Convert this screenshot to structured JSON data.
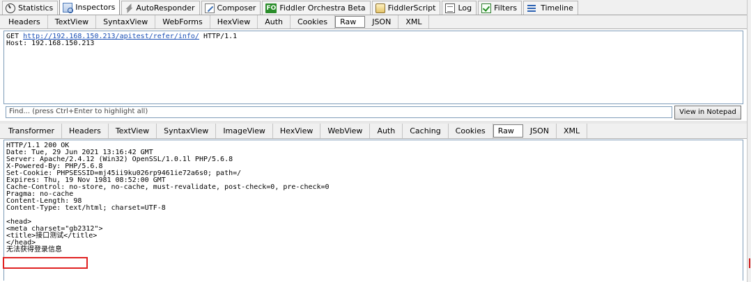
{
  "toptabs": [
    {
      "label": "Statistics",
      "icon": "stopwatch-icon"
    },
    {
      "label": "Inspectors",
      "icon": "inspectors-icon"
    },
    {
      "label": "AutoResponder",
      "icon": "lightning-icon"
    },
    {
      "label": "Composer",
      "icon": "pencil-icon"
    },
    {
      "label": "Fiddler Orchestra Beta",
      "icon": "fo-icon",
      "icon_text": "FO"
    },
    {
      "label": "FiddlerScript",
      "icon": "script-icon"
    },
    {
      "label": "Log",
      "icon": "log-icon"
    },
    {
      "label": "Filters",
      "icon": "checkbox-icon"
    },
    {
      "label": "Timeline",
      "icon": "timeline-icon"
    }
  ],
  "request_tabs": [
    "Headers",
    "TextView",
    "SyntaxView",
    "WebForms",
    "HexView",
    "Auth",
    "Cookies",
    "Raw",
    "JSON",
    "XML"
  ],
  "request": {
    "method": "GET",
    "url": "http://192.168.150.213/apitest/refer/info/",
    "protocol": "HTTP/1.1",
    "host_line": "Host: 192.168.150.213"
  },
  "find": {
    "placeholder": "Find... (press Ctrl+Enter to highlight all)",
    "button_label": "View in Notepad"
  },
  "response_tabs": [
    "Transformer",
    "Headers",
    "TextView",
    "SyntaxView",
    "ImageView",
    "HexView",
    "WebView",
    "Auth",
    "Caching",
    "Cookies",
    "Raw",
    "JSON",
    "XML"
  ],
  "response_lines": [
    "HTTP/1.1 200 OK",
    "Date: Tue, 29 Jun 2021 13:16:42 GMT",
    "Server: Apache/2.4.12 (Win32) OpenSSL/1.0.1l PHP/5.6.8",
    "X-Powered-By: PHP/5.6.8",
    "Set-Cookie: PHPSESSID=mj45ii9ku026rp9461ie72a6s0; path=/",
    "Expires: Thu, 19 Nov 1981 08:52:00 GMT",
    "Cache-Control: no-store, no-cache, must-revalidate, post-check=0, pre-check=0",
    "Pragma: no-cache",
    "Content-Length: 98",
    "Content-Type: text/html; charset=UTF-8",
    "",
    "<head>",
    "<meta charset=\"gb2312\">",
    "<title>接口测试</title>",
    "</head>",
    "无法获得登录信息"
  ],
  "colors": {
    "accent_link": "#1a4fb5",
    "highlight_box": "#e02020",
    "fo_badge": "#2a8d2a"
  }
}
